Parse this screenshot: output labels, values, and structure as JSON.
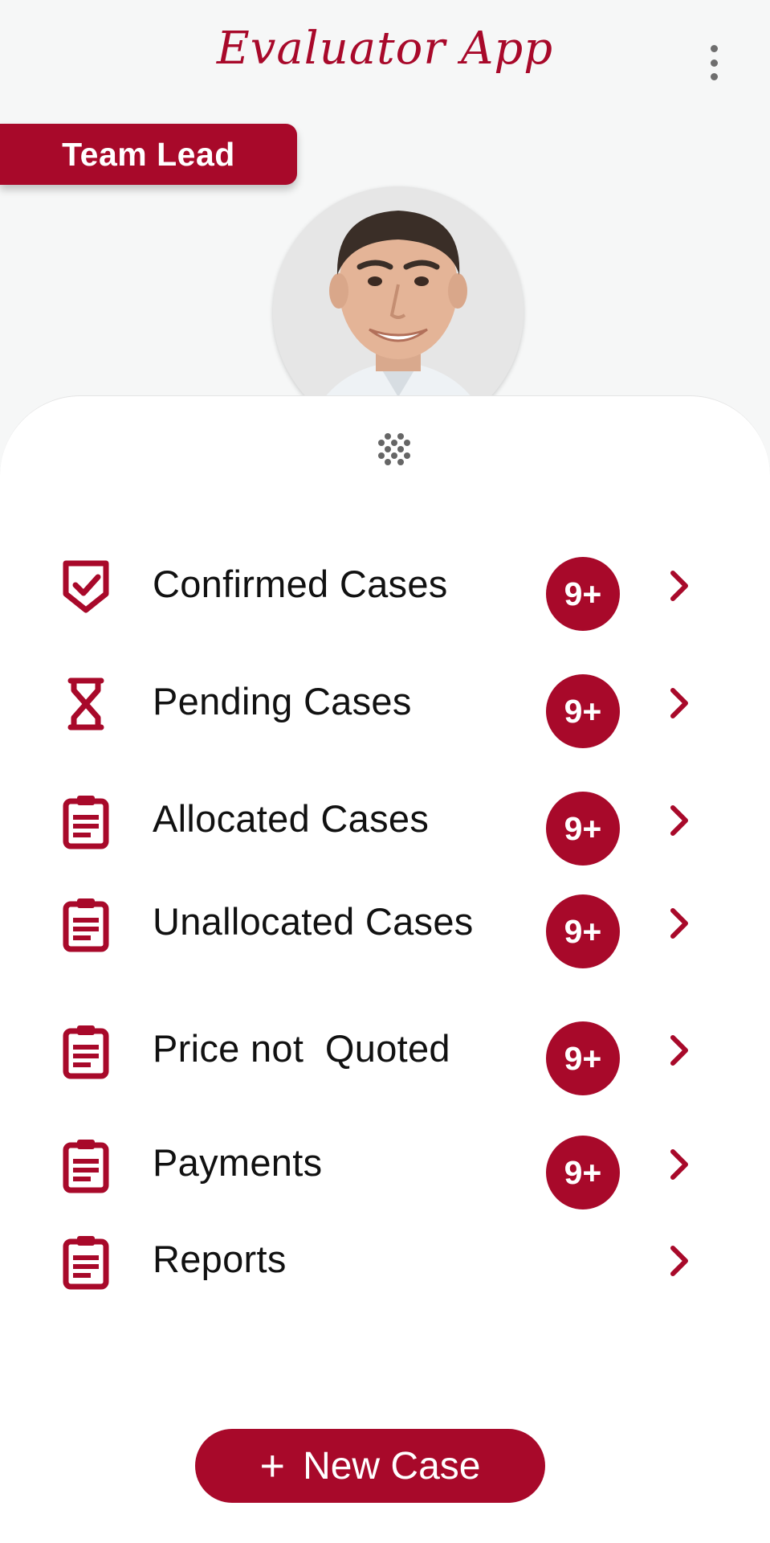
{
  "app": {
    "title": "Evaluator App",
    "role": "Team Lead",
    "accent": "#a8092a"
  },
  "menu": [
    {
      "icon": "shield-check-icon",
      "label": "Confirmed Cases",
      "badge": "9+"
    },
    {
      "icon": "hourglass-icon",
      "label": "Pending Cases",
      "badge": "9+"
    },
    {
      "icon": "clipboard-icon",
      "label": "Allocated Cases",
      "badge": "9+"
    },
    {
      "icon": "clipboard-icon",
      "label": "Unallocated Cases",
      "badge": "9+"
    },
    {
      "icon": "clipboard-icon",
      "label": "Price not  Quoted",
      "badge": "9+"
    },
    {
      "icon": "clipboard-icon",
      "label": "Payments",
      "badge": "9+"
    },
    {
      "icon": "clipboard-icon",
      "label": "Reports",
      "badge": ""
    }
  ],
  "actions": {
    "new_case_label": "New Case"
  }
}
